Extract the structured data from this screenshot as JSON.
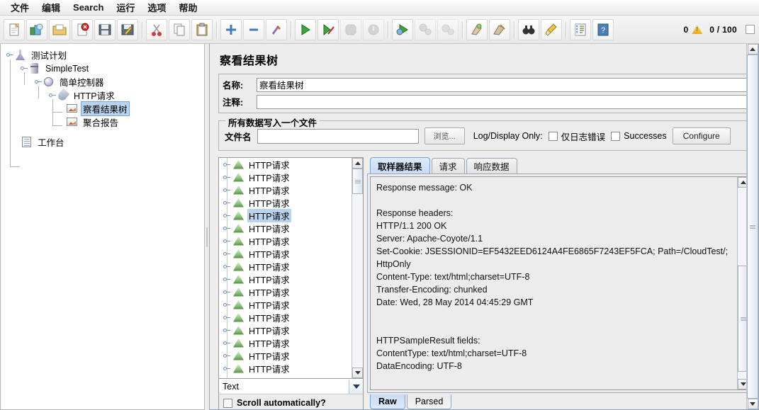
{
  "menu": {
    "items": [
      {
        "label": "文件",
        "name": "menu-file"
      },
      {
        "label": "编辑",
        "name": "menu-edit"
      },
      {
        "label": "Search",
        "name": "menu-search"
      },
      {
        "label": "运行",
        "name": "menu-run"
      },
      {
        "label": "选项",
        "name": "menu-options"
      },
      {
        "label": "帮助",
        "name": "menu-help"
      }
    ]
  },
  "toolbar": {
    "buttons": [
      {
        "icon": "new-document-icon",
        "enabled": true
      },
      {
        "icon": "templates-icon",
        "enabled": true
      },
      {
        "icon": "open-folder-icon",
        "enabled": true
      },
      {
        "icon": "close-document-icon",
        "enabled": true
      },
      {
        "icon": "save-icon",
        "enabled": true
      },
      {
        "icon": "save-as-icon",
        "enabled": true
      },
      {
        "icon": "cut-icon",
        "enabled": true
      },
      {
        "icon": "copy-icon",
        "enabled": true
      },
      {
        "icon": "paste-icon",
        "enabled": true
      },
      {
        "icon": "expand-plus-icon",
        "enabled": true
      },
      {
        "icon": "collapse-minus-icon",
        "enabled": true
      },
      {
        "icon": "toggle-icon",
        "enabled": true
      },
      {
        "icon": "start-icon",
        "enabled": true
      },
      {
        "icon": "start-no-timers-icon",
        "enabled": true
      },
      {
        "icon": "stop-icon",
        "enabled": false
      },
      {
        "icon": "shutdown-icon",
        "enabled": false
      },
      {
        "icon": "remote-start-icon",
        "enabled": true
      },
      {
        "icon": "remote-stop-icon",
        "enabled": false
      },
      {
        "icon": "remote-shutdown-icon",
        "enabled": false
      },
      {
        "icon": "clear-icon",
        "enabled": true
      },
      {
        "icon": "clear-all-icon",
        "enabled": true
      },
      {
        "icon": "search-binoculars-icon",
        "enabled": true
      },
      {
        "icon": "reset-search-broom-icon",
        "enabled": true
      },
      {
        "icon": "function-helper-icon",
        "enabled": true
      },
      {
        "icon": "help-icon",
        "enabled": true
      }
    ],
    "warning_count": "0",
    "warning_icon": "warning-triangle-icon",
    "thread_counter": "0 / 100"
  },
  "tree": {
    "nodes": [
      {
        "label": "测试计划",
        "icon": "test-plan-icon",
        "depth": 0,
        "selected": false
      },
      {
        "label": "SimpleTest",
        "icon": "thread-group-icon",
        "depth": 1,
        "selected": false
      },
      {
        "label": "简单控制器",
        "icon": "simple-controller-icon",
        "depth": 2,
        "selected": false
      },
      {
        "label": "HTTP请求",
        "icon": "http-request-icon",
        "depth": 3,
        "selected": false
      },
      {
        "label": "察看结果树",
        "icon": "view-results-tree-icon",
        "depth": 4,
        "selected": true
      },
      {
        "label": "聚合报告",
        "icon": "aggregate-report-icon",
        "depth": 4,
        "selected": false
      },
      {
        "label": "工作台",
        "icon": "workbench-icon",
        "depth": 1,
        "selected": false
      }
    ]
  },
  "panel": {
    "title": "察看结果树",
    "name_label": "名称:",
    "name_value": "察看结果树",
    "comment_label": "注释:",
    "comment_value": "",
    "comment_placeholder": "",
    "group_title": "所有数据写入一个文件",
    "filename_label": "文件名",
    "filename_value": "",
    "filename_placeholder": "",
    "browse_label": "浏览...",
    "log_display_label": "Log/Display Only:",
    "errors_checkbox_label": "仅日志错误",
    "errors_checked": false,
    "successes_checkbox_label": "Successes",
    "successes_checked": false,
    "configure_label": "Configure"
  },
  "results": {
    "rows": [
      {
        "label": "HTTP请求",
        "icon": "sample-success-icon",
        "selected": false
      },
      {
        "label": "HTTP请求",
        "icon": "sample-success-icon",
        "selected": false
      },
      {
        "label": "HTTP请求",
        "icon": "sample-success-icon",
        "selected": false
      },
      {
        "label": "HTTP请求",
        "icon": "sample-success-icon",
        "selected": false
      },
      {
        "label": "HTTP请求",
        "icon": "sample-success-icon",
        "selected": true
      },
      {
        "label": "HTTP请求",
        "icon": "sample-success-icon",
        "selected": false
      },
      {
        "label": "HTTP请求",
        "icon": "sample-success-icon",
        "selected": false
      },
      {
        "label": "HTTP请求",
        "icon": "sample-success-icon",
        "selected": false
      },
      {
        "label": "HTTP请求",
        "icon": "sample-success-icon",
        "selected": false
      },
      {
        "label": "HTTP请求",
        "icon": "sample-success-icon",
        "selected": false
      },
      {
        "label": "HTTP请求",
        "icon": "sample-success-icon",
        "selected": false
      },
      {
        "label": "HTTP请求",
        "icon": "sample-success-icon",
        "selected": false
      },
      {
        "label": "HTTP请求",
        "icon": "sample-success-icon",
        "selected": false
      },
      {
        "label": "HTTP请求",
        "icon": "sample-success-icon",
        "selected": false
      },
      {
        "label": "HTTP请求",
        "icon": "sample-success-icon",
        "selected": false
      },
      {
        "label": "HTTP请求",
        "icon": "sample-success-icon",
        "selected": false
      },
      {
        "label": "HTTP请求",
        "icon": "sample-success-icon",
        "selected": false
      }
    ],
    "render_selected": "Text",
    "scroll_auto_label": "Scroll automatically?",
    "scroll_auto_checked": false
  },
  "tabs": {
    "items": [
      {
        "label": "取样器结果",
        "active": true
      },
      {
        "label": "请求",
        "active": false
      },
      {
        "label": "响应数据",
        "active": false
      }
    ],
    "view_modes": [
      {
        "label": "Raw",
        "active": true
      },
      {
        "label": "Parsed",
        "active": false
      }
    ]
  },
  "response": {
    "text": "Response message: OK\n\nResponse headers:\nHTTP/1.1 200 OK\nServer: Apache-Coyote/1.1\nSet-Cookie: JSESSIONID=EF5432EED6124A4FE6865F7243EF5FCA; Path=/CloudTest/;\nHttpOnly\nContent-Type: text/html;charset=UTF-8\nTransfer-Encoding: chunked\nDate: Wed, 28 May 2014 04:45:29 GMT\n\n\nHTTPSampleResult fields:\nContentType: text/html;charset=UTF-8\nDataEncoding: UTF-8"
  },
  "colors": {
    "selection": "#b9d3ee",
    "tab_active": "#c9dcf4",
    "panel_bg": "#ececec",
    "warning": "#e8a91c"
  }
}
